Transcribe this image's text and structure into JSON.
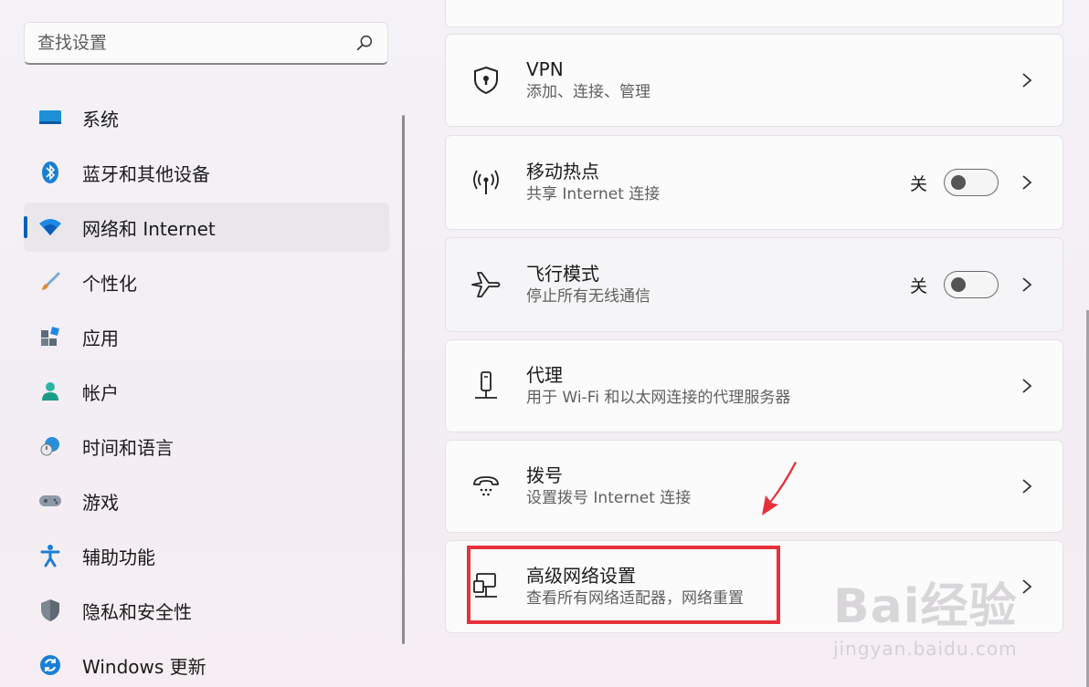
{
  "search": {
    "placeholder": "查找设置"
  },
  "sidebar": {
    "items": [
      {
        "label": "系统",
        "icon": "monitor-icon"
      },
      {
        "label": "蓝牙和其他设备",
        "icon": "bluetooth-icon"
      },
      {
        "label": "网络和 Internet",
        "icon": "wifi-icon",
        "active": true
      },
      {
        "label": "个性化",
        "icon": "brush-icon"
      },
      {
        "label": "应用",
        "icon": "apps-icon"
      },
      {
        "label": "帐户",
        "icon": "person-icon"
      },
      {
        "label": "时间和语言",
        "icon": "clock-globe-icon"
      },
      {
        "label": "游戏",
        "icon": "gamepad-icon"
      },
      {
        "label": "辅助功能",
        "icon": "accessibility-icon"
      },
      {
        "label": "隐私和安全性",
        "icon": "shield-icon"
      },
      {
        "label": "Windows 更新",
        "icon": "update-icon"
      }
    ]
  },
  "cards": [
    {
      "title": "VPN",
      "subtitle": "添加、连接、管理",
      "icon": "vpn-shield-icon"
    },
    {
      "title": "移动热点",
      "subtitle": "共享 Internet 连接",
      "icon": "hotspot-icon",
      "toggle_label": "关",
      "toggle_on": false
    },
    {
      "title": "飞行模式",
      "subtitle": "停止所有无线通信",
      "icon": "airplane-icon",
      "toggle_label": "关",
      "toggle_on": false
    },
    {
      "title": "代理",
      "subtitle": "用于 Wi-Fi 和以太网连接的代理服务器",
      "icon": "proxy-icon"
    },
    {
      "title": "拨号",
      "subtitle": "设置拨号 Internet 连接",
      "icon": "dialup-phone-icon"
    },
    {
      "title": "高级网络设置",
      "subtitle": "查看所有网络适配器，网络重置",
      "icon": "network-pc-icon"
    }
  ],
  "watermark": {
    "main": "Bai经验",
    "sub": "jingyan.baidu.com"
  },
  "colors": {
    "accent": "#005fb8",
    "highlight": "#e6313b"
  }
}
